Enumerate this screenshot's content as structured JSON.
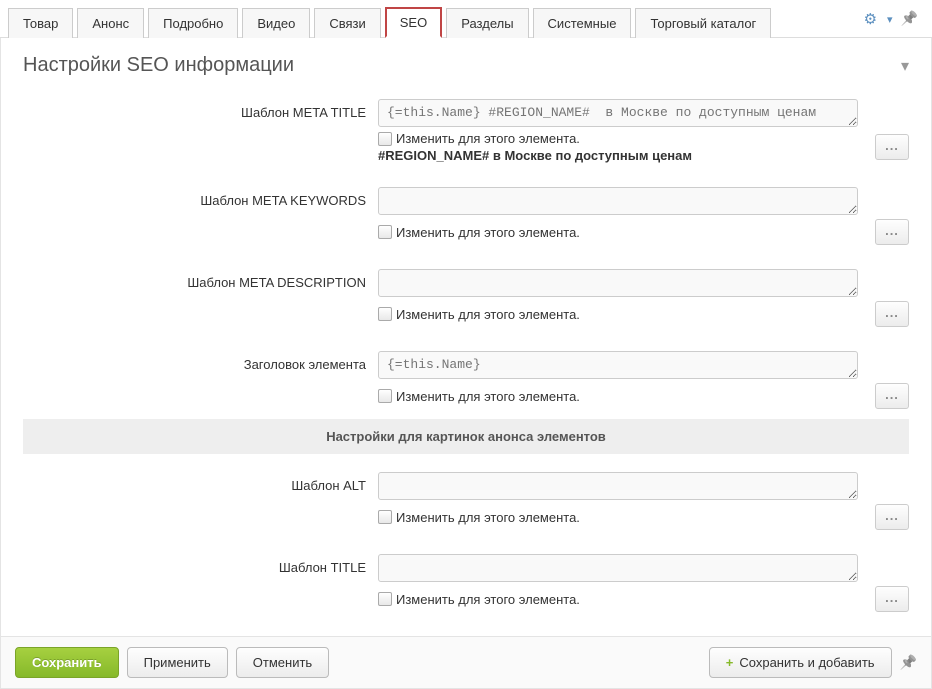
{
  "tabs": [
    {
      "label": "Товар"
    },
    {
      "label": "Анонс"
    },
    {
      "label": "Подробно"
    },
    {
      "label": "Видео"
    },
    {
      "label": "Связи"
    },
    {
      "label": "SEO",
      "active": true
    },
    {
      "label": "Разделы"
    },
    {
      "label": "Системные"
    },
    {
      "label": "Торговый каталог"
    }
  ],
  "panel": {
    "title": "Настройки SEO информации"
  },
  "fields": {
    "meta_title": {
      "label": "Шаблон META TITLE",
      "placeholder": "{=this.Name} #REGION_NAME#  в Москве по доступным ценам",
      "checkbox_label": "Изменить для этого элемента.",
      "preview": "#REGION_NAME# в Москве по доступным ценам"
    },
    "meta_keywords": {
      "label": "Шаблон META KEYWORDS",
      "placeholder": "",
      "checkbox_label": "Изменить для этого элемента."
    },
    "meta_description": {
      "label": "Шаблон META DESCRIPTION",
      "placeholder": "",
      "checkbox_label": "Изменить для этого элемента."
    },
    "element_title": {
      "label": "Заголовок элемента",
      "placeholder": "{=this.Name}",
      "checkbox_label": "Изменить для этого элемента."
    },
    "alt": {
      "label": "Шаблон ALT",
      "placeholder": "",
      "checkbox_label": "Изменить для этого элемента."
    },
    "title_tpl": {
      "label": "Шаблон TITLE",
      "placeholder": "",
      "checkbox_label": "Изменить для этого элемента."
    }
  },
  "section": {
    "heading": "Настройки для картинок анонса элементов"
  },
  "footer": {
    "save": "Сохранить",
    "apply": "Применить",
    "cancel": "Отменить",
    "save_add": "Сохранить и добавить"
  }
}
